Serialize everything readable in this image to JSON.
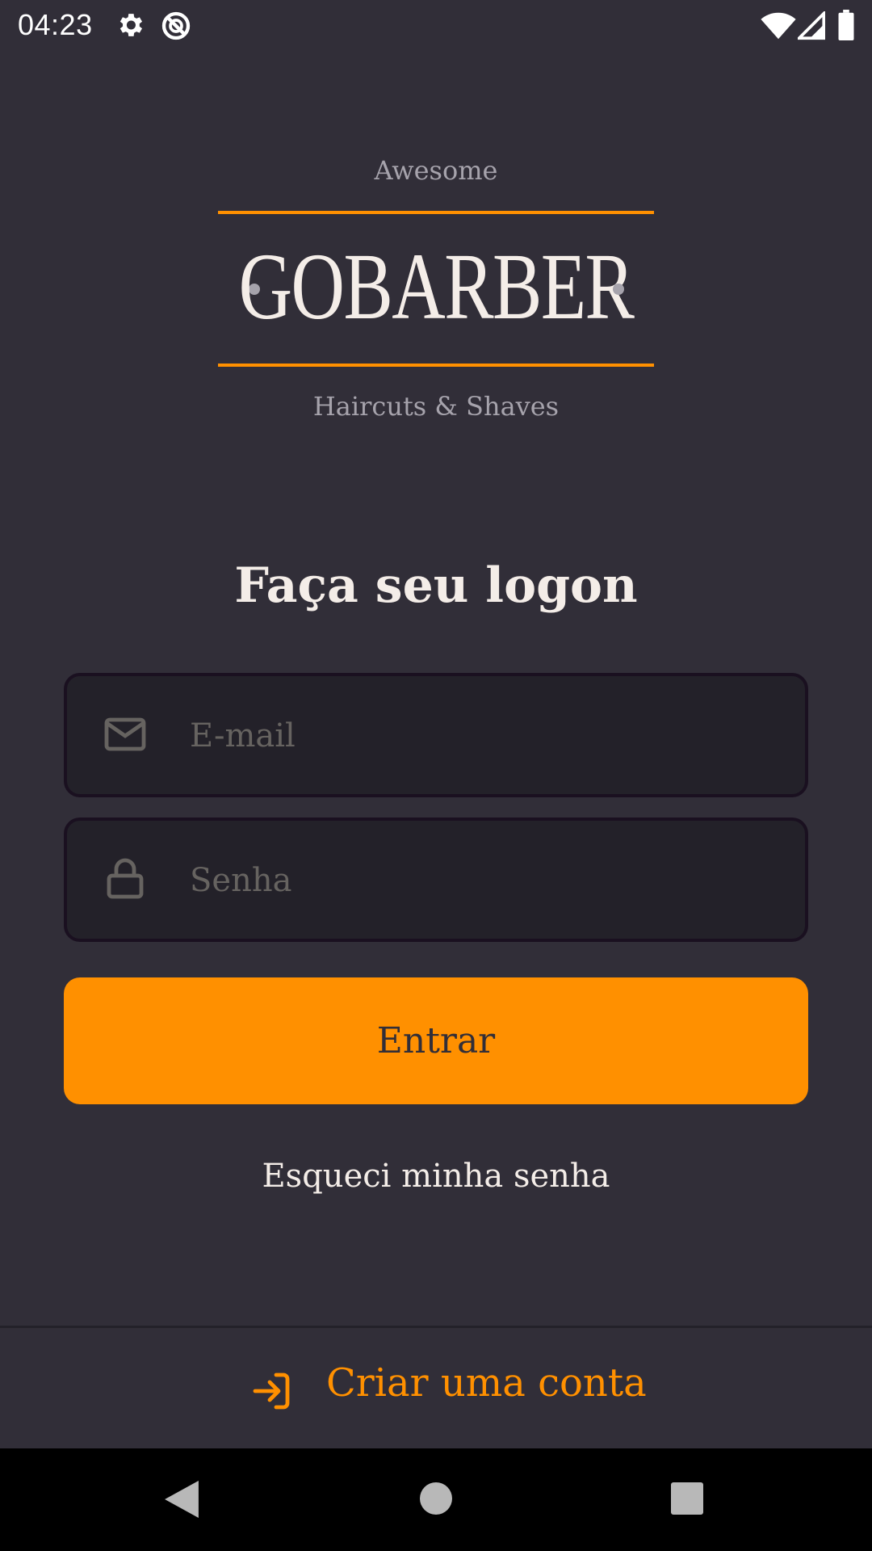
{
  "status_bar": {
    "time": "04:23",
    "icons": [
      "gear-icon",
      "do-not-disturb-icon",
      "wifi-icon",
      "cell-signal-icon",
      "battery-icon"
    ]
  },
  "logo": {
    "top_text": "Awesome",
    "brand": "GOBARBER",
    "bottom_text": "Haircuts & Shaves"
  },
  "form": {
    "title": "Faça seu logon",
    "email": {
      "placeholder": "E-mail",
      "value": "",
      "icon": "mail-icon"
    },
    "password": {
      "placeholder": "Senha",
      "value": "",
      "icon": "lock-icon"
    },
    "submit_label": "Entrar",
    "forgot_label": "Esqueci minha senha"
  },
  "footer": {
    "create_account_label": "Criar uma conta",
    "icon": "log-in-icon"
  },
  "nav_bar": {
    "buttons": [
      "back-icon",
      "home-icon",
      "recents-icon"
    ]
  },
  "colors": {
    "background": "#312e38",
    "input_background": "#232129",
    "accent": "#ff9000",
    "text": "#f4ede8",
    "muted": "#a6a3ac",
    "placeholder": "#666360"
  }
}
